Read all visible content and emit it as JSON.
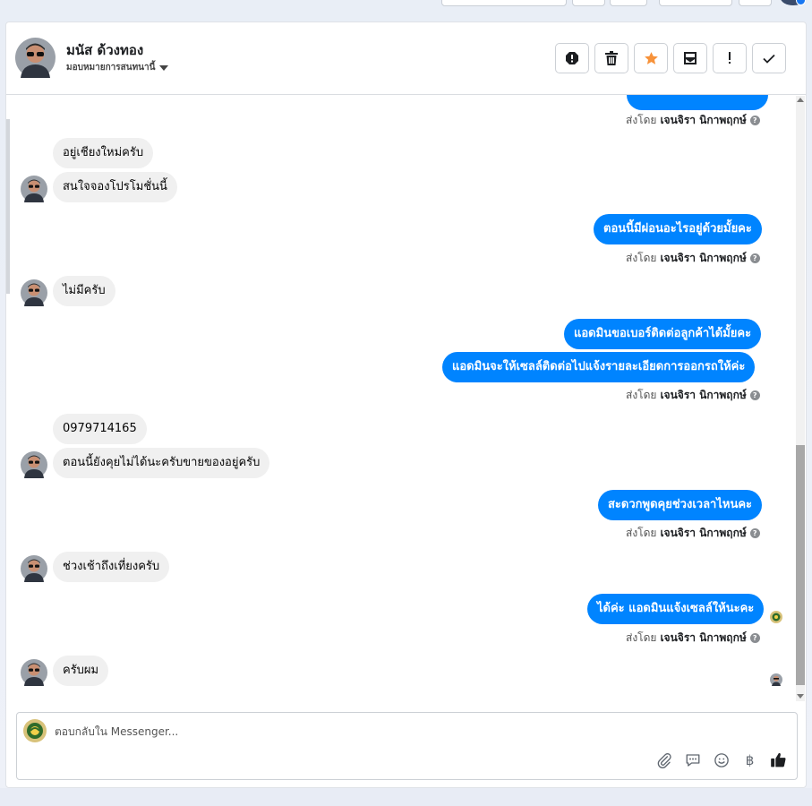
{
  "conversation": {
    "contact_name": "มนัส ด้วงทอง",
    "assign_label": "มอบหมายการสนทนานี้"
  },
  "header_actions": [
    {
      "name": "report-spam-icon",
      "color": "#1c1e21"
    },
    {
      "name": "trash-icon",
      "color": "#1c1e21"
    },
    {
      "name": "star-icon",
      "color": "#f7923a"
    },
    {
      "name": "mark-unread-icon",
      "color": "#1c1e21"
    },
    {
      "name": "exclamation-icon",
      "color": "#1c1e21"
    },
    {
      "name": "check-icon",
      "color": "#1c1e21"
    }
  ],
  "sent_by": {
    "prefix": "ส่งโดย",
    "agent": "เจนจิรา นิกาพฤกษ์",
    "help": "?"
  },
  "messages": [
    {
      "dir": "in",
      "text": "อยู่เชียงใหม่ครับ"
    },
    {
      "dir": "in",
      "text": "สนใจจองโปรโมชั่นนี้"
    },
    {
      "dir": "out",
      "text": "ตอนนี้มีผ่อนอะไรอยู่ด้วยมั้ยคะ"
    },
    {
      "dir": "in",
      "text": "ไม่มีครับ"
    },
    {
      "dir": "out",
      "text": "แอดมินขอเบอร์ติดต่อลูกค้าได้มั้ยคะ"
    },
    {
      "dir": "out",
      "text": "แอดมินจะให้เซลล์ติดต่อไปแจ้งรายละเอียดการออกรถให้ค่ะ"
    },
    {
      "dir": "in",
      "text": "0979714165"
    },
    {
      "dir": "in",
      "text": "ตอนนี้ยังคุยไม่ได้นะครับขายของอยู่ครับ"
    },
    {
      "dir": "out",
      "text": "สะดวกพูดคุยช่วงเวลาไหนคะ"
    },
    {
      "dir": "in",
      "text": "ช่วงเช้าถึงเที่ยงครับ"
    },
    {
      "dir": "out",
      "text": "ได้ค่ะ แอดมินแจ้งเซลล์ให้นะคะ"
    },
    {
      "dir": "in",
      "text": "ครับผม"
    }
  ],
  "composer": {
    "placeholder": "ตอบกลับใน Messenger...",
    "tools": [
      "attachment-icon",
      "saved-reply-icon",
      "emoji-icon",
      "baht-icon",
      "like-icon"
    ],
    "baht_symbol": "฿"
  },
  "colors": {
    "outgoing_bubble": "#0084ff",
    "incoming_bubble": "#f0f0f0",
    "accent_star": "#f7923a"
  }
}
